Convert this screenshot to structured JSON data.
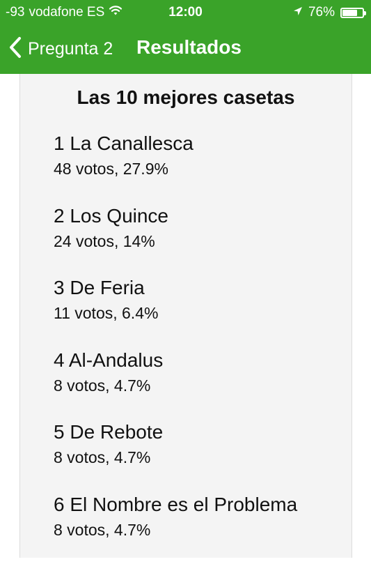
{
  "status_bar": {
    "signal": "-93",
    "carrier": "vodafone ES",
    "time": "12:00",
    "battery_percent": "76%",
    "battery_level": 0.76,
    "icons": [
      "wifi-icon",
      "location-arrow-icon",
      "battery-icon"
    ]
  },
  "nav": {
    "back_label": "Pregunta 2",
    "title": "Resultados",
    "background_color": "#3aa329"
  },
  "panel": {
    "title": "Las 10 mejores casetas"
  },
  "results": [
    {
      "rank": "1",
      "name": "La Canallesca",
      "stats": "48 votos, 27.9%"
    },
    {
      "rank": "2",
      "name": "Los Quince",
      "stats": "24 votos, 14%"
    },
    {
      "rank": "3",
      "name": "De Feria",
      "stats": "11 votos, 6.4%"
    },
    {
      "rank": "4",
      "name": "Al-Andalus",
      "stats": "8 votos, 4.7%"
    },
    {
      "rank": "5",
      "name": "De Rebote",
      "stats": "8 votos, 4.7%"
    },
    {
      "rank": "6",
      "name": "El Nombre es el Problema",
      "stats": "8 votos, 4.7%"
    }
  ]
}
